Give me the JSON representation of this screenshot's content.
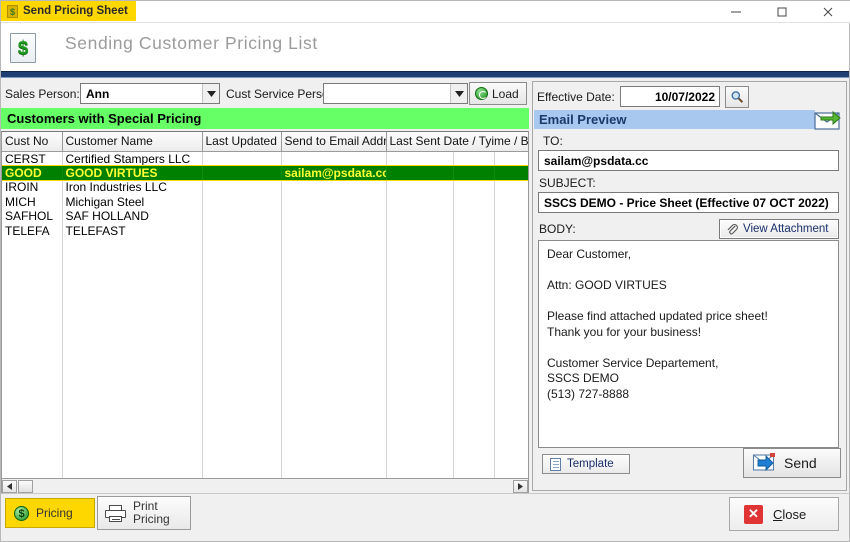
{
  "window": {
    "taskbar_tab": "Send Pricing Sheet",
    "header_title": "Sending Customer Pricing List",
    "minimize": "–",
    "maximize": "□",
    "close": "✕"
  },
  "filters": {
    "sales_person_label": "Sales Person:",
    "sales_person_value": "Ann",
    "cust_service_label": "Cust Service Person:",
    "cust_service_value": "",
    "load_label": "Load"
  },
  "grid": {
    "banner": "Customers with Special Pricing",
    "columns": [
      "Cust No",
      "Customer Name",
      "Last Updated",
      "Send to Email Addre",
      "Last Sent Date / Tyime / By",
      "",
      ""
    ],
    "rows": [
      {
        "cust_no": "CERST",
        "name": "Certified Stampers LLC",
        "last_updated": "",
        "email": "",
        "last_sent": "",
        "c6": "",
        "c7": "",
        "selected": false
      },
      {
        "cust_no": "GOOD",
        "name": "GOOD VIRTUES",
        "last_updated": "",
        "email": "sailam@psdata.cc",
        "last_sent": "",
        "c6": "",
        "c7": "",
        "selected": true
      },
      {
        "cust_no": "IROIN",
        "name": "Iron Industries LLC",
        "last_updated": "",
        "email": "",
        "last_sent": "",
        "c6": "",
        "c7": "",
        "selected": false
      },
      {
        "cust_no": "MICH",
        "name": "Michigan Steel",
        "last_updated": "",
        "email": "",
        "last_sent": "",
        "c6": "",
        "c7": "",
        "selected": false
      },
      {
        "cust_no": "SAFHOL",
        "name": "SAF HOLLAND",
        "last_updated": "",
        "email": "",
        "last_sent": "",
        "c6": "",
        "c7": "",
        "selected": false
      },
      {
        "cust_no": "TELEFA",
        "name": "TELEFAST",
        "last_updated": "",
        "email": "",
        "last_sent": "",
        "c6": "",
        "c7": "",
        "selected": false
      }
    ]
  },
  "preview": {
    "effective_date_label": "Effective Date:",
    "effective_date_value": "10/07/2022",
    "title": "Email Preview",
    "to_label": "TO:",
    "to_value": "sailam@psdata.cc",
    "subject_label": "SUBJECT:",
    "subject_value": "SSCS DEMO - Price Sheet  (Effective 07 OCT 2022)",
    "body_label": "BODY:",
    "view_attachment_label": "View Attachment",
    "body_value": "Dear Customer,\n\nAttn: GOOD VIRTUES\n\nPlease find attached updated price sheet!\nThank you for your business!\n\nCustomer Service Departement,\nSSCS DEMO\n(513) 727-8888",
    "template_label": "Template",
    "send_label": "Send"
  },
  "footer": {
    "pricing_label": "Pricing",
    "print_pricing_line1": "Print",
    "print_pricing_line2": "Pricing",
    "close_accel": "C",
    "close_rest": "lose"
  },
  "colors": {
    "banner_green": "#66ff66",
    "selected_row": "#008000",
    "selected_text": "#ffff33",
    "tab_yellow": "#ffd700",
    "preview_header": "#a8c8f0",
    "blue_bar": "#1f3f73",
    "close_red": "#e03434"
  }
}
